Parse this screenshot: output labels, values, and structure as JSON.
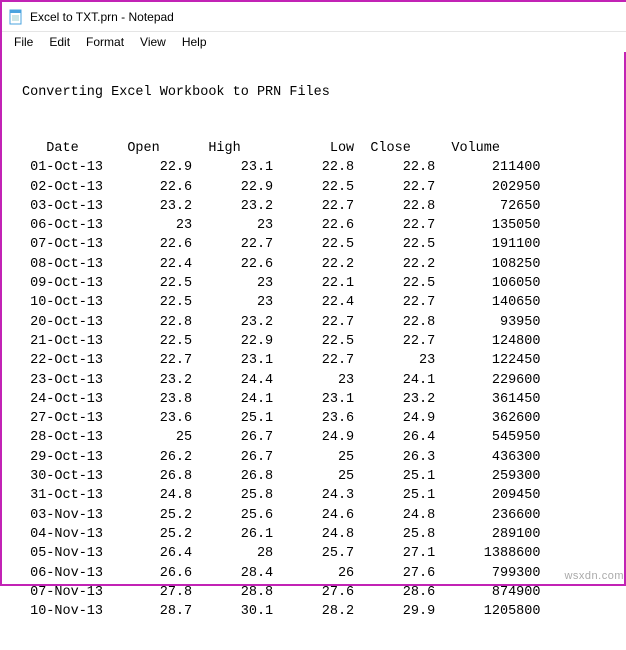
{
  "window": {
    "title": "Excel to TXT.prn - Notepad"
  },
  "menu": {
    "file": "File",
    "edit": "Edit",
    "format": "Format",
    "view": "View",
    "help": "Help"
  },
  "document": {
    "heading": "Converting Excel Workbook to PRN Files",
    "columns": [
      "Date",
      "Open",
      "High",
      "Low",
      "Close",
      "Volume"
    ],
    "rows": [
      {
        "date": "01-Oct-13",
        "open": "22.9",
        "high": "23.1",
        "low": "22.8",
        "close": "22.8",
        "volume": "211400"
      },
      {
        "date": "02-Oct-13",
        "open": "22.6",
        "high": "22.9",
        "low": "22.5",
        "close": "22.7",
        "volume": "202950"
      },
      {
        "date": "03-Oct-13",
        "open": "23.2",
        "high": "23.2",
        "low": "22.7",
        "close": "22.8",
        "volume": "72650"
      },
      {
        "date": "06-Oct-13",
        "open": "23",
        "high": "23",
        "low": "22.6",
        "close": "22.7",
        "volume": "135050"
      },
      {
        "date": "07-Oct-13",
        "open": "22.6",
        "high": "22.7",
        "low": "22.5",
        "close": "22.5",
        "volume": "191100"
      },
      {
        "date": "08-Oct-13",
        "open": "22.4",
        "high": "22.6",
        "low": "22.2",
        "close": "22.2",
        "volume": "108250"
      },
      {
        "date": "09-Oct-13",
        "open": "22.5",
        "high": "23",
        "low": "22.1",
        "close": "22.5",
        "volume": "106050"
      },
      {
        "date": "10-Oct-13",
        "open": "22.5",
        "high": "23",
        "low": "22.4",
        "close": "22.7",
        "volume": "140650"
      },
      {
        "date": "20-Oct-13",
        "open": "22.8",
        "high": "23.2",
        "low": "22.7",
        "close": "22.8",
        "volume": "93950"
      },
      {
        "date": "21-Oct-13",
        "open": "22.5",
        "high": "22.9",
        "low": "22.5",
        "close": "22.7",
        "volume": "124800"
      },
      {
        "date": "22-Oct-13",
        "open": "22.7",
        "high": "23.1",
        "low": "22.7",
        "close": "23",
        "volume": "122450"
      },
      {
        "date": "23-Oct-13",
        "open": "23.2",
        "high": "24.4",
        "low": "23",
        "close": "24.1",
        "volume": "229600"
      },
      {
        "date": "24-Oct-13",
        "open": "23.8",
        "high": "24.1",
        "low": "23.1",
        "close": "23.2",
        "volume": "361450"
      },
      {
        "date": "27-Oct-13",
        "open": "23.6",
        "high": "25.1",
        "low": "23.6",
        "close": "24.9",
        "volume": "362600"
      },
      {
        "date": "28-Oct-13",
        "open": "25",
        "high": "26.7",
        "low": "24.9",
        "close": "26.4",
        "volume": "545950"
      },
      {
        "date": "29-Oct-13",
        "open": "26.2",
        "high": "26.7",
        "low": "25",
        "close": "26.3",
        "volume": "436300"
      },
      {
        "date": "30-Oct-13",
        "open": "26.8",
        "high": "26.8",
        "low": "25",
        "close": "25.1",
        "volume": "259300"
      },
      {
        "date": "31-Oct-13",
        "open": "24.8",
        "high": "25.8",
        "low": "24.3",
        "close": "25.1",
        "volume": "209450"
      },
      {
        "date": "03-Nov-13",
        "open": "25.2",
        "high": "25.6",
        "low": "24.6",
        "close": "24.8",
        "volume": "236600"
      },
      {
        "date": "04-Nov-13",
        "open": "25.2",
        "high": "26.1",
        "low": "24.8",
        "close": "25.8",
        "volume": "289100"
      },
      {
        "date": "05-Nov-13",
        "open": "26.4",
        "high": "28",
        "low": "25.7",
        "close": "27.1",
        "volume": "1388600"
      },
      {
        "date": "06-Nov-13",
        "open": "26.6",
        "high": "28.4",
        "low": "26",
        "close": "27.6",
        "volume": "799300"
      },
      {
        "date": "07-Nov-13",
        "open": "27.8",
        "high": "28.8",
        "low": "27.6",
        "close": "28.6",
        "volume": "874900"
      },
      {
        "date": "10-Nov-13",
        "open": "28.7",
        "high": "30.1",
        "low": "28.2",
        "close": "29.9",
        "volume": "1205800"
      }
    ]
  },
  "watermark": "wsxdn.com"
}
